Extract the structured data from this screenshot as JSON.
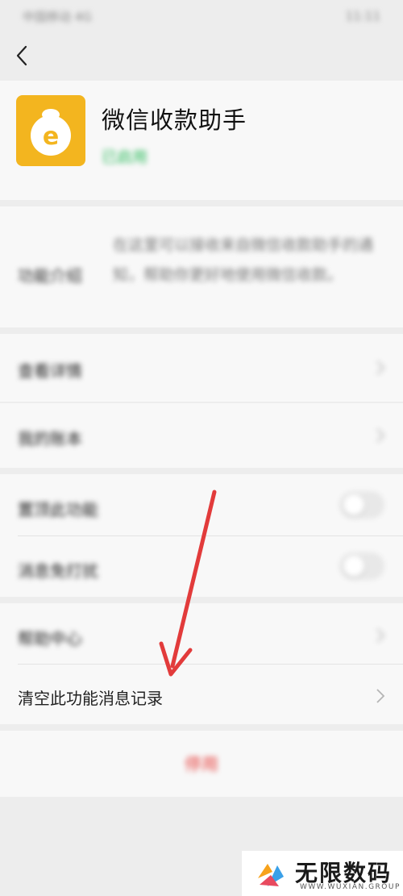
{
  "status_bar": {
    "carrier": "中国移动 4G",
    "time": "11:11"
  },
  "app": {
    "name": "微信收款助手",
    "status": "已启用",
    "brand_color": "#f3b51f",
    "status_color": "#2dbb5c"
  },
  "intro": {
    "label": "功能介绍",
    "text": "在这里可以接收来自微信收款助手的通知，帮助你更好地使用微信收款。"
  },
  "menu": {
    "view_details": "查看详情",
    "my_account": "我的账本",
    "pin_feature": "置顶此功能",
    "mute_notifications": "消息免打扰",
    "help_center": "帮助中心",
    "clear_records": "清空此功能消息记录"
  },
  "toggles": {
    "pin_feature": false,
    "mute_notifications": false
  },
  "action": {
    "label": "停用",
    "color": "#e64340"
  },
  "watermark": {
    "name": "无限数码",
    "sub": "WWW.WUXIAN.GROUP"
  },
  "annotation": {
    "arrow_color": "#e23b3b"
  }
}
